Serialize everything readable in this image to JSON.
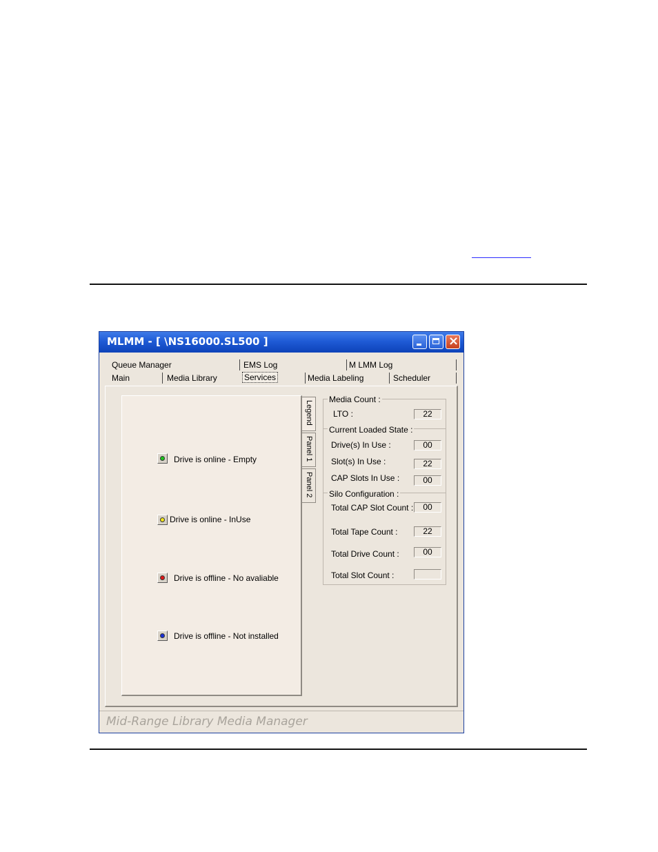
{
  "window": {
    "title": "MLMM - [ \\NS16000.SL500 ]",
    "status_text": "Mid-Range Library Media Manager"
  },
  "tabs": {
    "row1": [
      "Queue Manager",
      "EMS Log",
      "M LMM Log"
    ],
    "row2": [
      "Main",
      "Media Library",
      "Services",
      "Media Labeling",
      "Scheduler"
    ],
    "active": "Services"
  },
  "side_tabs": [
    "Legend",
    "Panel 1",
    "Panel 2"
  ],
  "legend": [
    {
      "label": "Drive is online - Empty",
      "color": "#1fc41f"
    },
    {
      "label": "Drive is online - InUse",
      "color": "#f2e51a"
    },
    {
      "label": "Drive is offline - No avaliable",
      "color": "#e01818"
    },
    {
      "label": "Drive is offline - Not installed",
      "color": "#1a2fd8"
    }
  ],
  "media_count": {
    "title": "Media Count :",
    "lto_label": "LTO :",
    "lto_value": "22"
  },
  "current_loaded_state": {
    "title": "Current Loaded State :",
    "drives_label": "Drive(s) In Use :",
    "drives_value": "00",
    "slots_label": "Slot(s) In Use :",
    "slots_value": "22",
    "cap_label": "CAP Slots In Use :",
    "cap_value": "00"
  },
  "silo_configuration": {
    "title": "Silo Configuration :",
    "cap_count_label": "Total CAP Slot Count :",
    "cap_count_value": "00",
    "tape_count_label": "Total Tape Count :",
    "tape_count_value": "22",
    "drive_count_label": "Total Drive Count :",
    "drive_count_value": "00",
    "slot_count_label": "Total Slot Count :",
    "slot_count_value": ""
  }
}
